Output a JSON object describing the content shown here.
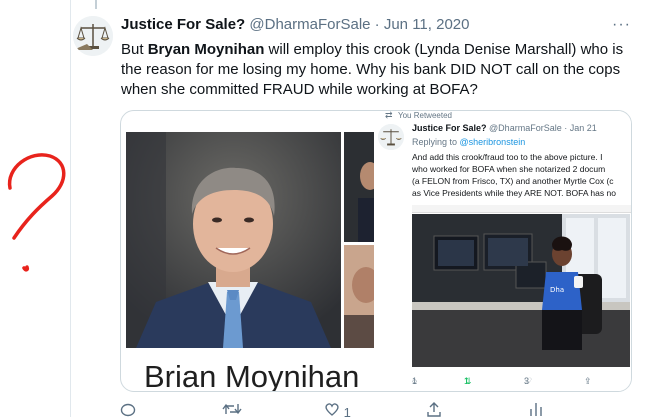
{
  "tweet": {
    "author_name": "Justice For Sale?",
    "author_handle": "@DharmaForSale",
    "separator": "·",
    "date": "Jun 11, 2020",
    "more": "···",
    "text_1": "But ",
    "text_bold": "Bryan Moynihan",
    "text_2": " will employ this crook (Lynda Denise Marshall) who is the reason for me losing my home. Why his bank DID NOT call on the cops when she committed FRAUD while working at BOFA?"
  },
  "media": {
    "caption": "Brian Moynihan"
  },
  "retweet": {
    "label": "You Retweeted",
    "author_name": "Justice For Sale?",
    "author_handle": "@DharmaForSale",
    "separator": "·",
    "date": "Jan 21",
    "replying_prefix": "Replying to ",
    "replying_handle": "@sheribronstein",
    "lines": [
      "And add this crook/fraud too to the above picture. I",
      "who worked for BOFA when she notarized 2 docum",
      "(a FELON from Frisco, TX) and another Myrtle Cox (c",
      "as Vice Presidents while they ARE NOT. BOFA has no"
    ],
    "counts": {
      "replies": "1",
      "retweets": "1",
      "likes": "3"
    }
  },
  "actions": {
    "reply_count": "",
    "retweet_count": "",
    "like_count": "1"
  },
  "colors": {
    "link": "#1b95e0",
    "muted": "#5b7083",
    "retweet_active": "#17bf63",
    "scribble": "#e8231c"
  }
}
